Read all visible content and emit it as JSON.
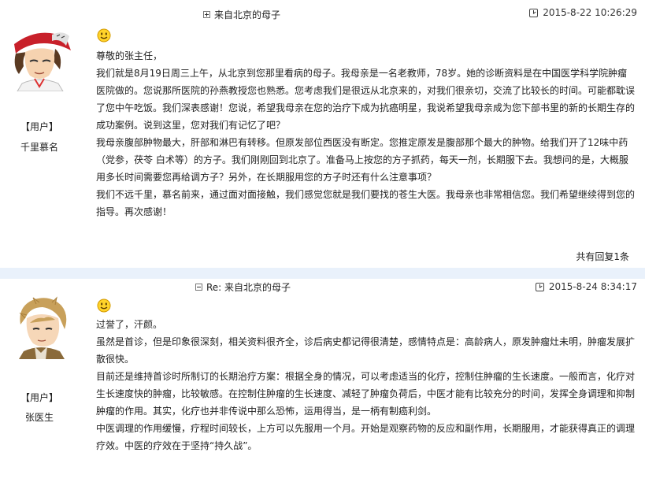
{
  "post1": {
    "title": "来自北京的母子",
    "timestamp": "2015-8-22 10:26:29",
    "author_role": "【用户】",
    "author_name": "千里慕名",
    "paragraphs": [
      "尊敬的张主任，",
      "我们就是8月19日周三上午，从北京到您那里看病的母子。我母亲是一名老教师，78岁。她的诊断资料是在中国医学科学院肿瘤医院做的。您说那所医院的孙燕教授您也熟悉。您考虑我们是很远从北京来的，对我们很亲切，交流了比较长的时间。可能都耽误了您中午吃饭。我们深表感谢！您说，希望我母亲在您的治疗下成为抗癌明星，我说希望我母亲成为您下部书里的新的长期生存的成功案例。说到这里，您对我们有记忆了吧？",
      "我母亲腹部肿物最大，肝部和淋巴有转移。但原发部位西医没有断定。您推定原发是腹部那个最大的肿物。给我们开了12味中药（党参，茯苓 白术等）的方子。我们刚刚回到北京了。准备马上按您的方子抓药，每天一剂，长期服下去。我想问的是，大概服用多长时间需要您再给调方子？另外，在长期服用您的方子时还有什么注意事项？",
      "我们不远千里，慕名前来，通过面对面接触，我们感觉您就是我们要找的苍生大医。我母亲也非常相信您。我们希望继续得到您的指导。再次感谢！"
    ],
    "reply_count": "共有回复1条"
  },
  "post2": {
    "title": "Re: 来自北京的母子",
    "timestamp": "2015-8-24 8:34:17",
    "author_role": "【用户】",
    "author_name": "张医生",
    "paragraphs": [
      "过誉了，汗颜。",
      "虽然是首诊，但是印象很深刻，相关资料很齐全，诊后病史都记得很清楚，感情特点是：高龄病人，原发肿瘤灶未明，肿瘤发展扩散很快。",
      "目前还是维持首诊时所制订的长期治疗方案：根据全身的情况，可以考虑适当的化疗，控制住肿瘤的生长速度。一般而言，化疗对生长速度快的肿瘤，比较敏感。在控制住肿瘤的生长速度、减轻了肿瘤负荷后，中医才能有比较充分的时间，发挥全身调理和抑制肿瘤的作用。其实，化疗也并非传说中那么恐怖，运用得当，是一柄有制癌利剑。",
      "中医调理的作用缓慢，疗程时间较长，上方可以先服用一个月。开始是观察药物的反应和副作用，长期服用，才能获得真正的调理疗效。中医的疗效在于坚持“持久战”。"
    ]
  }
}
